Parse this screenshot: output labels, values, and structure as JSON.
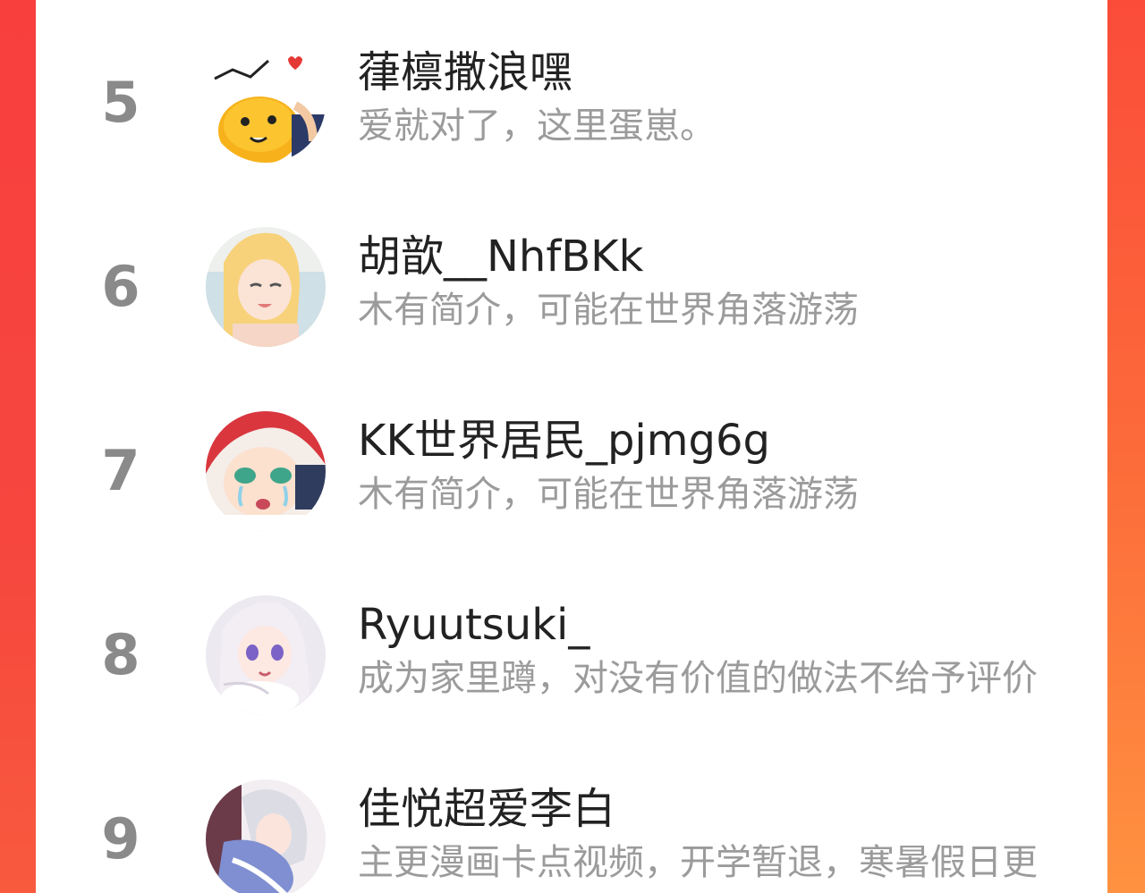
{
  "colors": {
    "frame_top": "#f8443c",
    "frame_bottom": "#fe8a3c",
    "panel": "#ffffff",
    "rank_text": "#8a8a8a",
    "name_text": "#222222",
    "bio_text": "#9b9b9b"
  },
  "users": [
    {
      "rank": "5",
      "name": "葎檩撒浪嘿",
      "bio": "爱就对了，这里蛋崽。",
      "avatar_icon": "egg-character-avatar-icon"
    },
    {
      "rank": "6",
      "name": "胡歆__NhfBKk",
      "bio": "木有简介，可能在世界角落游荡",
      "avatar_icon": "blonde-girl-avatar-icon"
    },
    {
      "rank": "7",
      "name": "KK世界居民_pjmg6g",
      "bio": "木有简介，可能在世界角落游荡",
      "avatar_icon": "crying-girl-avatar-icon"
    },
    {
      "rank": "8",
      "name": "Ryuutsuki_",
      "bio": "成为家里蹲，对没有价值的做法不给予评价",
      "avatar_icon": "white-hair-girl-avatar-icon"
    },
    {
      "rank": "9",
      "name": "佳悦超爱李白",
      "bio": "主更漫画卡点视频，开学暂退，寒暑假日更",
      "avatar_icon": "anime-couple-avatar-icon"
    }
  ]
}
